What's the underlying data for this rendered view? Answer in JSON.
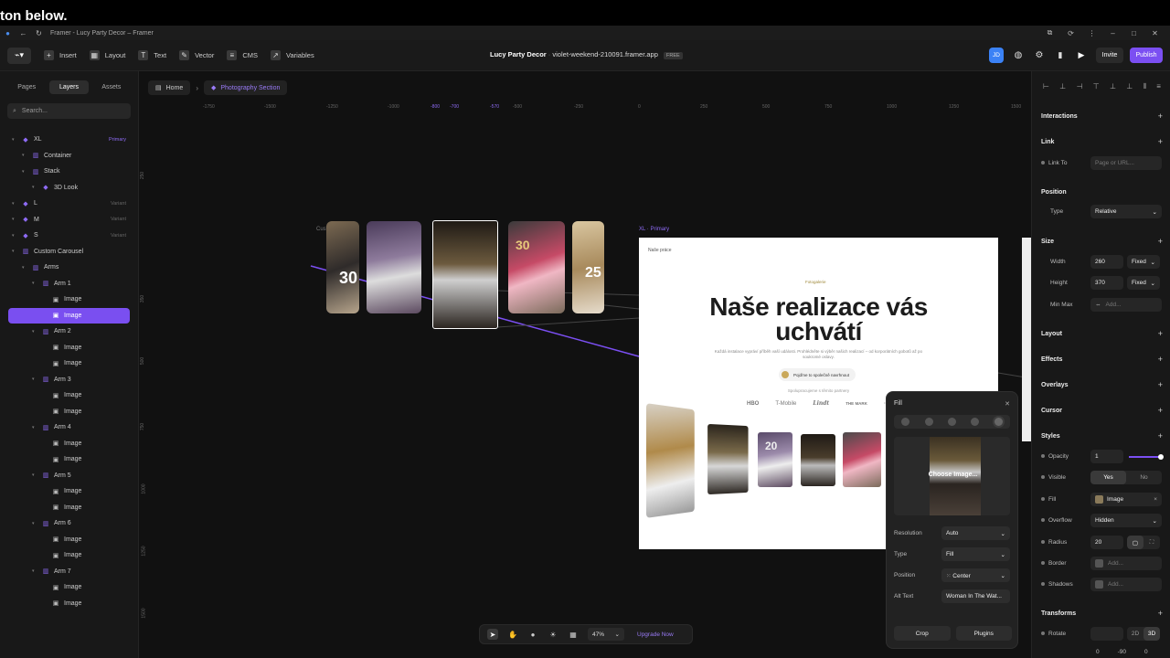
{
  "caption": "ton below.",
  "browser": {
    "tab_title": "Framer - Lucy Party Decor – Framer"
  },
  "toolbar": {
    "insert": "Insert",
    "layout": "Layout",
    "text": "Text",
    "vector": "Vector",
    "cms": "CMS",
    "variables": "Variables",
    "project_name": "Lucy Party Decor",
    "domain": "violet-weekend-210091.framer.app",
    "plan_badge": "FREE",
    "avatar": "JD",
    "invite": "Invite",
    "publish": "Publish",
    "accent": "#7b4ff2"
  },
  "left_panel": {
    "tabs": [
      "Pages",
      "Layers",
      "Assets"
    ],
    "active_tab": "Layers",
    "search_placeholder": "Search...",
    "layers": [
      {
        "label": "XL",
        "tag": "Primary",
        "kind": "component",
        "indent": 0
      },
      {
        "label": "Container",
        "tag": "",
        "kind": "frame",
        "indent": 1
      },
      {
        "label": "Stack",
        "tag": "",
        "kind": "frame",
        "indent": 1
      },
      {
        "label": "3D Look",
        "tag": "",
        "kind": "component",
        "indent": 2
      },
      {
        "label": "L",
        "tag": "Variant",
        "kind": "component",
        "indent": 0
      },
      {
        "label": "M",
        "tag": "Variant",
        "kind": "component",
        "indent": 0
      },
      {
        "label": "S",
        "tag": "Variant",
        "kind": "component",
        "indent": 0
      },
      {
        "label": "Custom Carousel",
        "tag": "",
        "kind": "frame",
        "indent": 0
      },
      {
        "label": "Arms",
        "tag": "",
        "kind": "frame",
        "indent": 1
      },
      {
        "label": "Arm 1",
        "tag": "",
        "kind": "frame",
        "indent": 2
      },
      {
        "label": "Image",
        "tag": "",
        "kind": "image",
        "indent": 3
      },
      {
        "label": "Image",
        "tag": "",
        "kind": "image",
        "indent": 3,
        "selected": true
      },
      {
        "label": "Arm 2",
        "tag": "",
        "kind": "frame",
        "indent": 2
      },
      {
        "label": "Image",
        "tag": "",
        "kind": "image",
        "indent": 3
      },
      {
        "label": "Image",
        "tag": "",
        "kind": "image",
        "indent": 3
      },
      {
        "label": "Arm 3",
        "tag": "",
        "kind": "frame",
        "indent": 2
      },
      {
        "label": "Image",
        "tag": "",
        "kind": "image",
        "indent": 3
      },
      {
        "label": "Image",
        "tag": "",
        "kind": "image",
        "indent": 3
      },
      {
        "label": "Arm 4",
        "tag": "",
        "kind": "frame",
        "indent": 2
      },
      {
        "label": "Image",
        "tag": "",
        "kind": "image",
        "indent": 3
      },
      {
        "label": "Image",
        "tag": "",
        "kind": "image",
        "indent": 3
      },
      {
        "label": "Arm 5",
        "tag": "",
        "kind": "frame",
        "indent": 2
      },
      {
        "label": "Image",
        "tag": "",
        "kind": "image",
        "indent": 3
      },
      {
        "label": "Image",
        "tag": "",
        "kind": "image",
        "indent": 3
      },
      {
        "label": "Arm 6",
        "tag": "",
        "kind": "frame",
        "indent": 2
      },
      {
        "label": "Image",
        "tag": "",
        "kind": "image",
        "indent": 3
      },
      {
        "label": "Image",
        "tag": "",
        "kind": "image",
        "indent": 3
      },
      {
        "label": "Arm 7",
        "tag": "",
        "kind": "frame",
        "indent": 2
      },
      {
        "label": "Image",
        "tag": "",
        "kind": "image",
        "indent": 3
      },
      {
        "label": "Image",
        "tag": "",
        "kind": "image",
        "indent": 3
      }
    ]
  },
  "canvas": {
    "breadcrumb_home": "Home",
    "breadcrumb_section": "Photography Section",
    "ruler_ticks": [
      "-1750",
      "-1500",
      "-1250",
      "-1000",
      "-800",
      "-700",
      "-570",
      "-500",
      "-250",
      "0",
      "250",
      "500",
      "750",
      "1000",
      "1250",
      "1500"
    ],
    "vruler_ticks": [
      "250",
      "350",
      "500",
      "750",
      "1000",
      "1250",
      "1500"
    ],
    "carousel_label": "Custom Carousel",
    "frame_label": "XL · Primary",
    "site": {
      "tag": "Naše práce",
      "pill": "Fotogalerie",
      "headline_1": "Naše realizace vás",
      "headline_2": "uchvátí",
      "sub": "Každá instalace vypráví příběh vaší události. Prohlédněte si výběr našich realizací – od korporátních gobotů až po soukromé oslavy.",
      "cta": "Pojďme to společně navrhnout",
      "trust": "Spolupracujeme s těmito partnery",
      "logos": [
        "HBO",
        "T-Mobile",
        "Lindt",
        "THE MARK",
        "···"
      ]
    },
    "photo_numbers": [
      "30",
      "20",
      "30",
      "25"
    ]
  },
  "fill_panel": {
    "title": "Fill",
    "choose_image": "Choose Image...",
    "rows": [
      {
        "label": "Resolution",
        "value": "Auto"
      },
      {
        "label": "Type",
        "value": "Fill"
      },
      {
        "label": "Position",
        "value": "Center"
      },
      {
        "label": "Alt Text",
        "value": "Woman In The Wat..."
      }
    ],
    "crop": "Crop",
    "plugins": "Plugins"
  },
  "bottom_bar": {
    "zoom": "47%",
    "upgrade": "Upgrade Now"
  },
  "right_panel": {
    "interactions": "Interactions",
    "link": "Link",
    "link_to": "Link To",
    "link_placeholder": "Page or URL...",
    "position": "Position",
    "type_label": "Type",
    "type_value": "Relative",
    "size": "Size",
    "width_label": "Width",
    "width_value": "260",
    "width_mode": "Fixed",
    "height_label": "Height",
    "height_value": "370",
    "height_mode": "Fixed",
    "minmax_label": "Min Max",
    "add": "Add...",
    "layout": "Layout",
    "effects": "Effects",
    "overlays": "Overlays",
    "cursor": "Cursor",
    "styles": "Styles",
    "opacity_label": "Opacity",
    "opacity_value": "1",
    "visible_label": "Visible",
    "yes": "Yes",
    "no": "No",
    "fill_label": "Fill",
    "fill_value": "Image",
    "overflow_label": "Overflow",
    "overflow_value": "Hidden",
    "radius_label": "Radius",
    "radius_value": "20",
    "border_label": "Border",
    "shadows_label": "Shadows",
    "transforms": "Transforms",
    "rotate_label": "Rotate",
    "mode_2d": "2D",
    "mode_3d": "3D",
    "rot_x": "0",
    "rot_y": "-90",
    "rot_z": "0"
  }
}
